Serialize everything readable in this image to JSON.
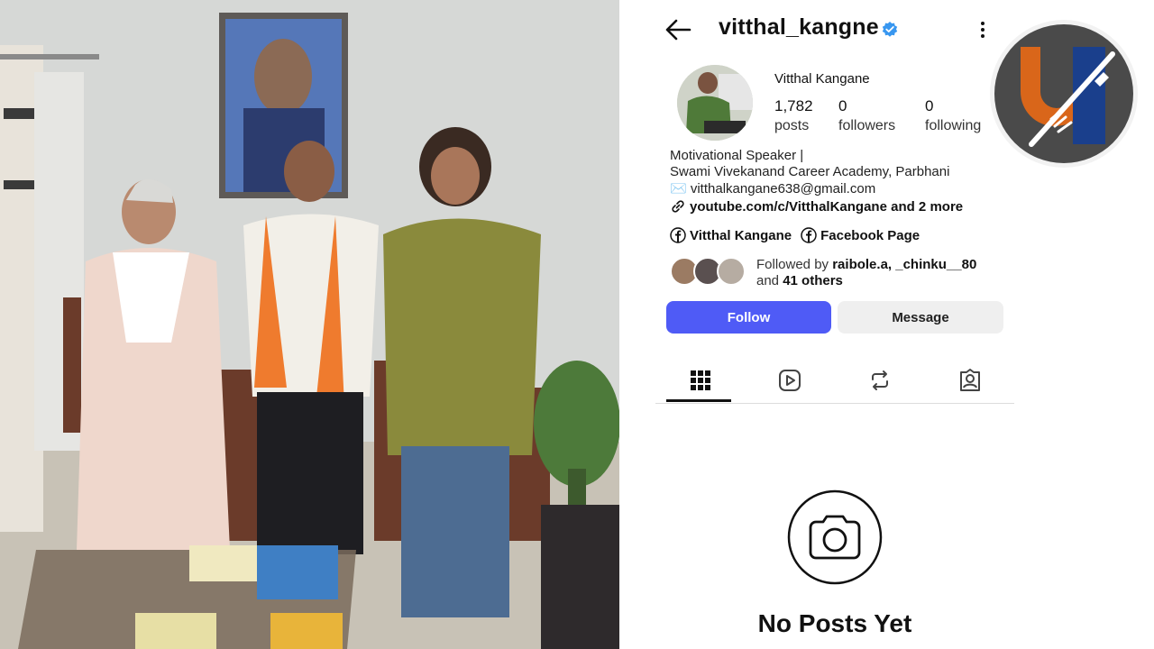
{
  "profile": {
    "username": "vitthal_kangne",
    "display_name": "Vitthal Kangane",
    "verified_icon": "verified-badge-icon",
    "stats": [
      {
        "value": "1,782",
        "label": "posts"
      },
      {
        "value": "0",
        "label": "followers"
      },
      {
        "value": "0",
        "label": "following"
      }
    ],
    "bio": {
      "line1": "Motivational Speaker |",
      "line2": "Swami Vivekanand Career Academy, Parbhani",
      "email": "✉️ vitthalkangane638@gmail.com",
      "link": "youtube.com/c/VitthalKangane and 2 more"
    },
    "facebook_links": [
      {
        "label": "Vitthal Kangane"
      },
      {
        "label": "Facebook Page"
      }
    ],
    "followed_by": {
      "prefix": "Followed by ",
      "names": "raibole.a, _chinku__80",
      "and": "and ",
      "others": "41 others"
    },
    "buttons": {
      "follow": "Follow",
      "message": "Message"
    },
    "tabs": [
      "grid-icon",
      "reels-icon",
      "reposts-icon",
      "tagged-icon"
    ],
    "empty_state": "No Posts Yet"
  },
  "colors": {
    "follow_button": "#4f5bf6",
    "message_button": "#efefef",
    "verified": "#3897f0",
    "badge_orange": "#d9661a",
    "badge_blue": "#1a3f8c",
    "badge_ring": "#4a4a4a"
  }
}
